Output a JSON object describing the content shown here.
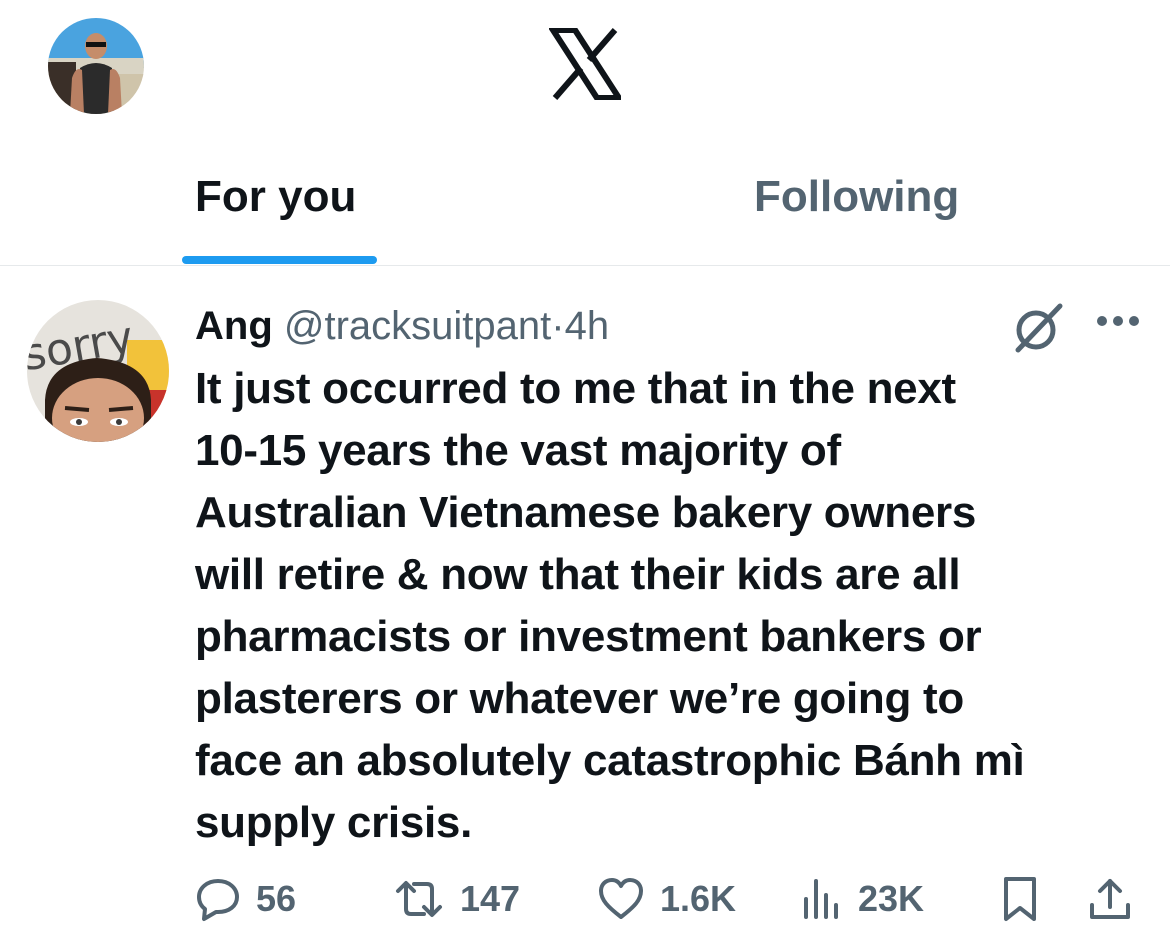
{
  "header": {
    "logo_icon": "x-logo-icon",
    "profile_avatar_icon": "profile-avatar"
  },
  "tabs": [
    {
      "label": "For you",
      "active": true
    },
    {
      "label": "Following",
      "active": false
    }
  ],
  "colors": {
    "accent": "#1d9bf0",
    "text_primary": "#0f1419",
    "text_secondary": "#536471"
  },
  "tweet": {
    "author_name": "Ang",
    "author_handle": "@tracksuitpant",
    "separator": "·",
    "timestamp": "4h",
    "avatar_text": "sorry",
    "text": "It just occurred to me that in the next\n10-15 years the vast majority of\nAustralian Vietnamese bakery owners\nwill retire & now that their kids are all\npharmacists or investment bankers or\nplasterers or whatever we’re going to\nface an absolutely catastrophic Bánh mì\nsupply crisis.",
    "actions": {
      "replies": "56",
      "reposts": "147",
      "likes": "1.6K",
      "views": "23K"
    }
  }
}
